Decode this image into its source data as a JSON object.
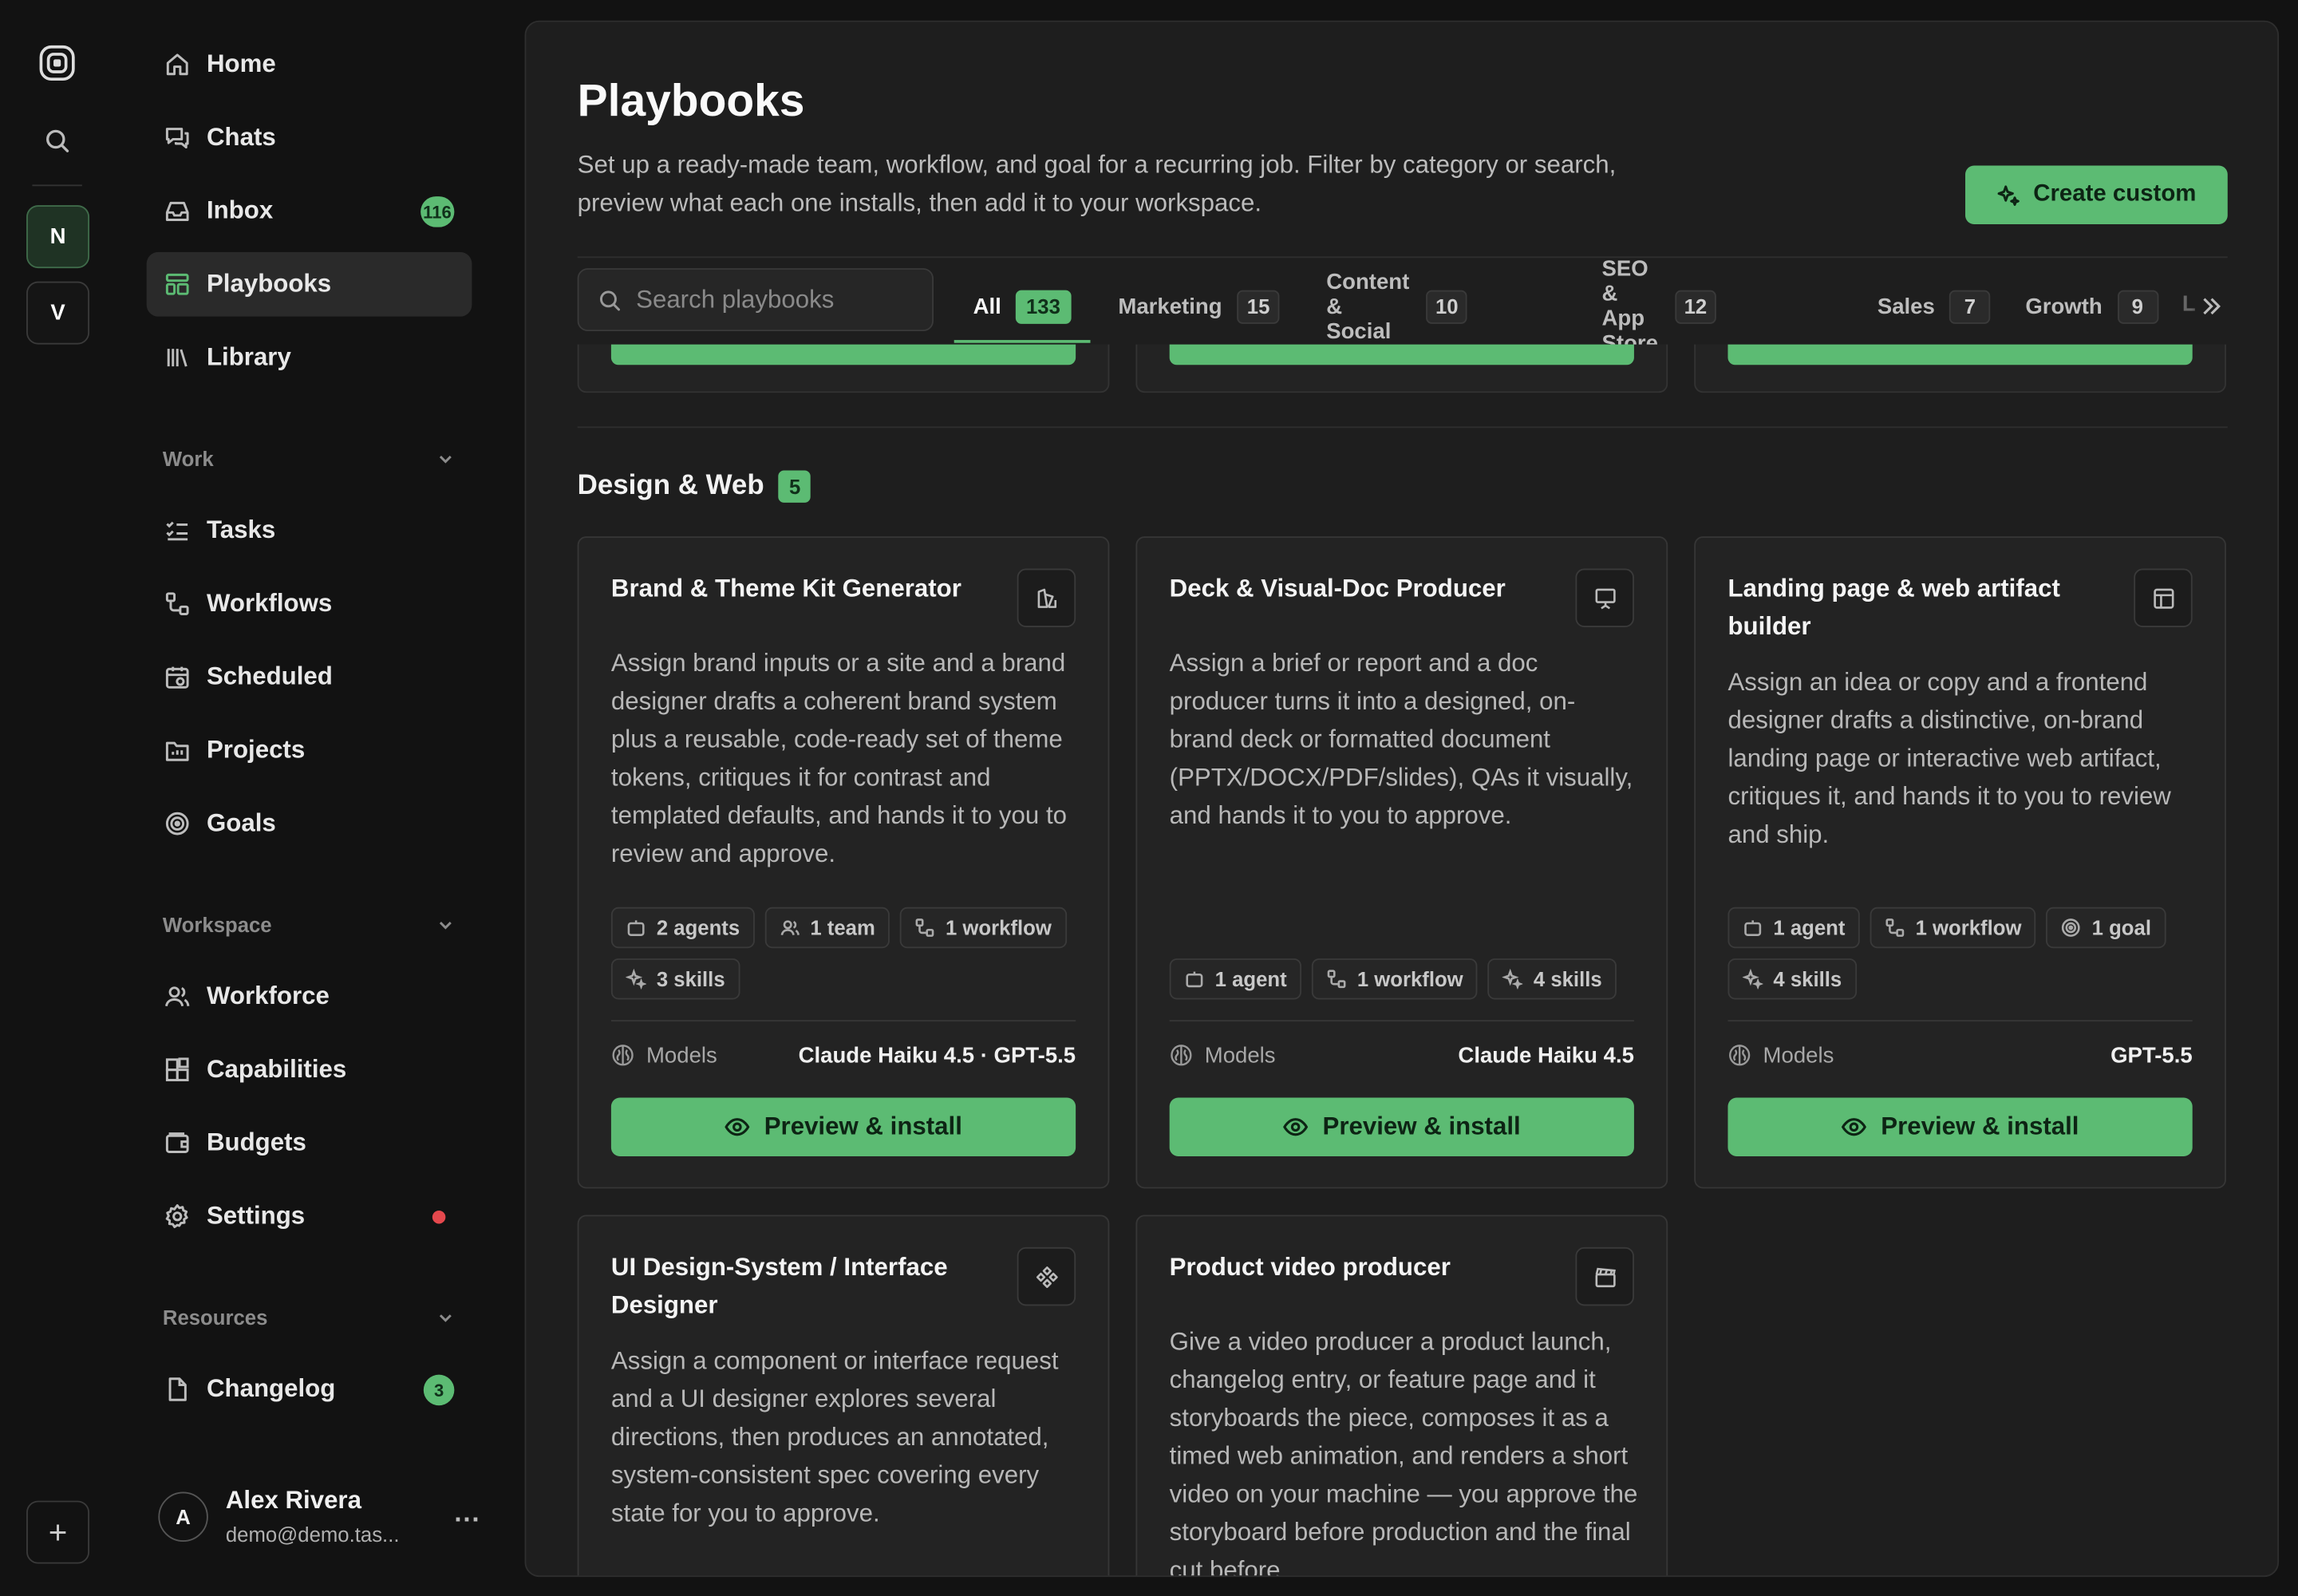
{
  "rail": {
    "workspaces": [
      "N",
      "V"
    ],
    "add_label": "+"
  },
  "sidebar": {
    "primary": [
      {
        "label": "Home",
        "icon": "home-icon"
      },
      {
        "label": "Chats",
        "icon": "chats-icon"
      },
      {
        "label": "Inbox",
        "icon": "inbox-icon",
        "badge": "116"
      },
      {
        "label": "Playbooks",
        "icon": "playbooks-icon",
        "active": true
      },
      {
        "label": "Library",
        "icon": "library-icon"
      }
    ],
    "work": {
      "label": "Work",
      "items": [
        {
          "label": "Tasks",
          "icon": "tasks-icon"
        },
        {
          "label": "Workflows",
          "icon": "workflows-icon"
        },
        {
          "label": "Scheduled",
          "icon": "scheduled-icon"
        },
        {
          "label": "Projects",
          "icon": "projects-icon"
        },
        {
          "label": "Goals",
          "icon": "goals-icon"
        }
      ]
    },
    "workspace": {
      "label": "Workspace",
      "items": [
        {
          "label": "Workforce",
          "icon": "workforce-icon"
        },
        {
          "label": "Capabilities",
          "icon": "capabilities-icon"
        },
        {
          "label": "Budgets",
          "icon": "budgets-icon"
        },
        {
          "label": "Settings",
          "icon": "settings-icon",
          "dot": true
        }
      ]
    },
    "resources": {
      "label": "Resources",
      "items": [
        {
          "label": "Changelog",
          "icon": "changelog-icon",
          "badge": "3"
        }
      ]
    },
    "user": {
      "initial": "A",
      "name": "Alex Rivera",
      "email": "demo@demo.tas...",
      "more": "..."
    }
  },
  "page": {
    "title": "Playbooks",
    "subtitle": "Set up a ready-made team, workflow, and goal for a recurring job. Filter by category or search, preview what each one installs, then add it to your workspace.",
    "create_label": "Create custom",
    "search_placeholder": "Search playbooks",
    "tabs": [
      {
        "label": "All",
        "count": "133",
        "active": true
      },
      {
        "label": "Marketing",
        "count": "15"
      },
      {
        "label": "Content & Social",
        "count": "10"
      },
      {
        "label": "SEO & App Store",
        "count": "12"
      },
      {
        "label": "Sales",
        "count": "7"
      },
      {
        "label": "Growth",
        "count": "9"
      }
    ],
    "tab_overflow_label": "L"
  },
  "section": {
    "name": "Design & Web",
    "count": "5",
    "models_label": "Models",
    "install_label": "Preview & install",
    "cards": [
      {
        "title": "Brand & Theme Kit Generator",
        "icon": "brand-kit-icon",
        "description": "Assign brand inputs or a site and a brand designer drafts a coherent brand system plus a reusable, code-ready set of theme tokens, critiques it for contrast and templated defaults, and hands it to you to review and approve.",
        "chips": [
          {
            "label": "2 agents",
            "icon": "agent-icon"
          },
          {
            "label": "1 team",
            "icon": "team-icon"
          },
          {
            "label": "1 workflow",
            "icon": "workflow-icon"
          },
          {
            "label": "3 skills",
            "icon": "skills-icon"
          }
        ],
        "models": "Claude Haiku 4.5 · GPT-5.5"
      },
      {
        "title": "Deck & Visual-Doc Producer",
        "icon": "presentation-icon",
        "description": "Assign a brief or report and a doc producer turns it into a designed, on-brand deck or formatted document (PPTX/DOCX/PDF/slides), QAs it visually, and hands it to you to approve.",
        "chips": [
          {
            "label": "1 agent",
            "icon": "agent-icon"
          },
          {
            "label": "1 workflow",
            "icon": "workflow-icon"
          },
          {
            "label": "4 skills",
            "icon": "skills-icon"
          }
        ],
        "models": "Claude Haiku 4.5"
      },
      {
        "title": "Landing page & web artifact builder",
        "icon": "layout-icon",
        "description": "Assign an idea or copy and a frontend designer drafts a distinctive, on-brand landing page or interactive web artifact, critiques it, and hands it to you to review and ship.",
        "chips": [
          {
            "label": "1 agent",
            "icon": "agent-icon"
          },
          {
            "label": "1 workflow",
            "icon": "workflow-icon"
          },
          {
            "label": "1 goal",
            "icon": "goal-icon"
          },
          {
            "label": "4 skills",
            "icon": "skills-icon"
          }
        ],
        "models": "GPT-5.5"
      },
      {
        "title": "UI Design-System / Interface Designer",
        "icon": "component-icon",
        "description": "Assign a component or interface request and a UI designer explores several directions, then produces an annotated, system-consistent spec covering every state for you to approve."
      },
      {
        "title": "Product video producer",
        "icon": "clapperboard-icon",
        "description": "Give a video producer a product launch, changelog entry, or feature page and it storyboards the piece, composes it as a timed web animation, and renders a short video on your machine — you approve the storyboard before production and the final cut before"
      }
    ]
  },
  "colors": {
    "accent": "#5cbb73",
    "background": "#121212",
    "panel": "#1e1e1e",
    "card": "#232323",
    "alert": "#e5484d"
  }
}
